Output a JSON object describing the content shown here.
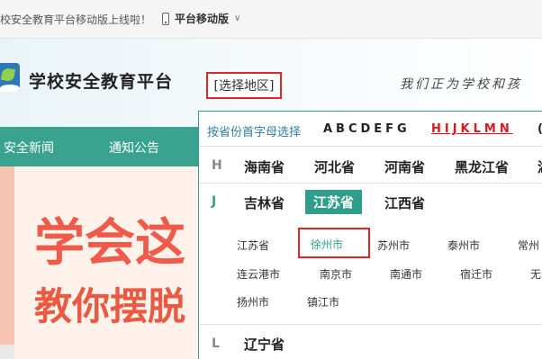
{
  "topbar": {
    "notice": "校安全教育平台移动版上线啦！",
    "mobile_label": "平台移动版",
    "chevron": "∨"
  },
  "header": {
    "site_title": "学校安全教育平台",
    "region_button": "[选择地区]",
    "slogan": "我们正为学校和孩"
  },
  "nav": {
    "items": [
      "安全新闻",
      "通知公告"
    ]
  },
  "banner": {
    "line1": "学会这",
    "line2": "教你摆脱"
  },
  "region_picker": {
    "hint": "按省份首字母选择",
    "letter_groups": [
      "ABCDEFG",
      "HIJKLMN",
      "("
    ],
    "active_group": "HIJKLMN",
    "rows": {
      "h": {
        "letter": "H",
        "provinces": [
          "海南省",
          "河北省",
          "河南省",
          "黑龙江省",
          "湖"
        ]
      },
      "j": {
        "letter": "J",
        "provinces": [
          "吉林省",
          "江苏省",
          "江西省"
        ],
        "active": "江苏省"
      },
      "l": {
        "letter": "L",
        "provinces": [
          "辽宁省"
        ]
      }
    },
    "cities": [
      [
        "江苏省",
        "徐州市",
        "苏州市",
        "泰州市",
        "常州"
      ],
      [
        "连云港市",
        "南京市",
        "南通市",
        "宿迁市",
        "无"
      ],
      [
        "扬州市",
        "镇江市"
      ]
    ],
    "selected_city": "徐州市"
  },
  "colors": {
    "accent": "#3aa390",
    "highlight_border": "#e0262b",
    "active_letters": "#d7191e",
    "link_blue": "#2f7fa3"
  }
}
